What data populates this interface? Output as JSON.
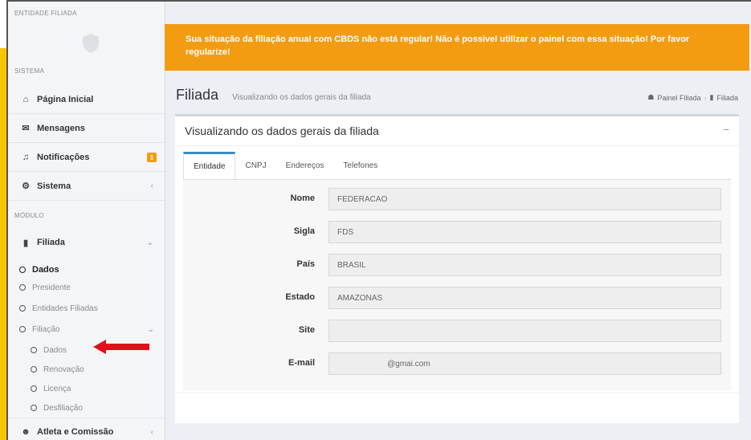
{
  "sidebar": {
    "entity_header": "ENTIDADE FILIADA",
    "system_header": "SISTEMA",
    "module_header": "MÓDULO",
    "items": [
      {
        "label": "Página Inicial",
        "icon": "home-icon"
      },
      {
        "label": "Mensagens",
        "icon": "envelope-icon"
      },
      {
        "label": "Notificações",
        "icon": "bell-icon",
        "badge": "1"
      },
      {
        "label": "Sistema",
        "icon": "cogs-icon"
      },
      {
        "label": "Filiada",
        "icon": "book-icon"
      },
      {
        "label": "Atleta e Comissão",
        "icon": "users-icon"
      }
    ],
    "submenu": {
      "dados": "Dados",
      "presidente": "Presidente",
      "entidades_filiadas": "Entidades Filiadas",
      "filiacao": "Filiação",
      "filiacao_children": [
        "Dados",
        "Renovação",
        "Licença",
        "Desfiliação"
      ]
    }
  },
  "alert": {
    "text": "Sua situação da filiação anual com CBDS não está regular! Não é possivel utilizar o painel com essa situação! Por favor regularize!",
    "color": "#f39c12"
  },
  "header": {
    "title": "Filiada",
    "subtitle": "Visualizando os dados gerais da filiada",
    "breadcrumb": [
      "Painel Filiada",
      "Filiada"
    ]
  },
  "box": {
    "title": "Visualizando os dados gerais da filiada",
    "minimize": "−",
    "tabs": [
      "Entidade",
      "CNPJ",
      "Endereços",
      "Telefones"
    ],
    "fields": [
      {
        "label": "Nome",
        "value": "FEDERACAO"
      },
      {
        "label": "Sigla",
        "value": "FDS"
      },
      {
        "label": "País",
        "value": "BRASIL"
      },
      {
        "label": "Estado",
        "value": "AMAZONAS"
      },
      {
        "label": "Site",
        "value": ""
      },
      {
        "label": "E-mail",
        "value": "@gmai.com"
      }
    ]
  },
  "colors": {
    "accent_tab": "#3c8dbc",
    "arrow": "#e0101b",
    "frame_accent": "#f9c400"
  }
}
